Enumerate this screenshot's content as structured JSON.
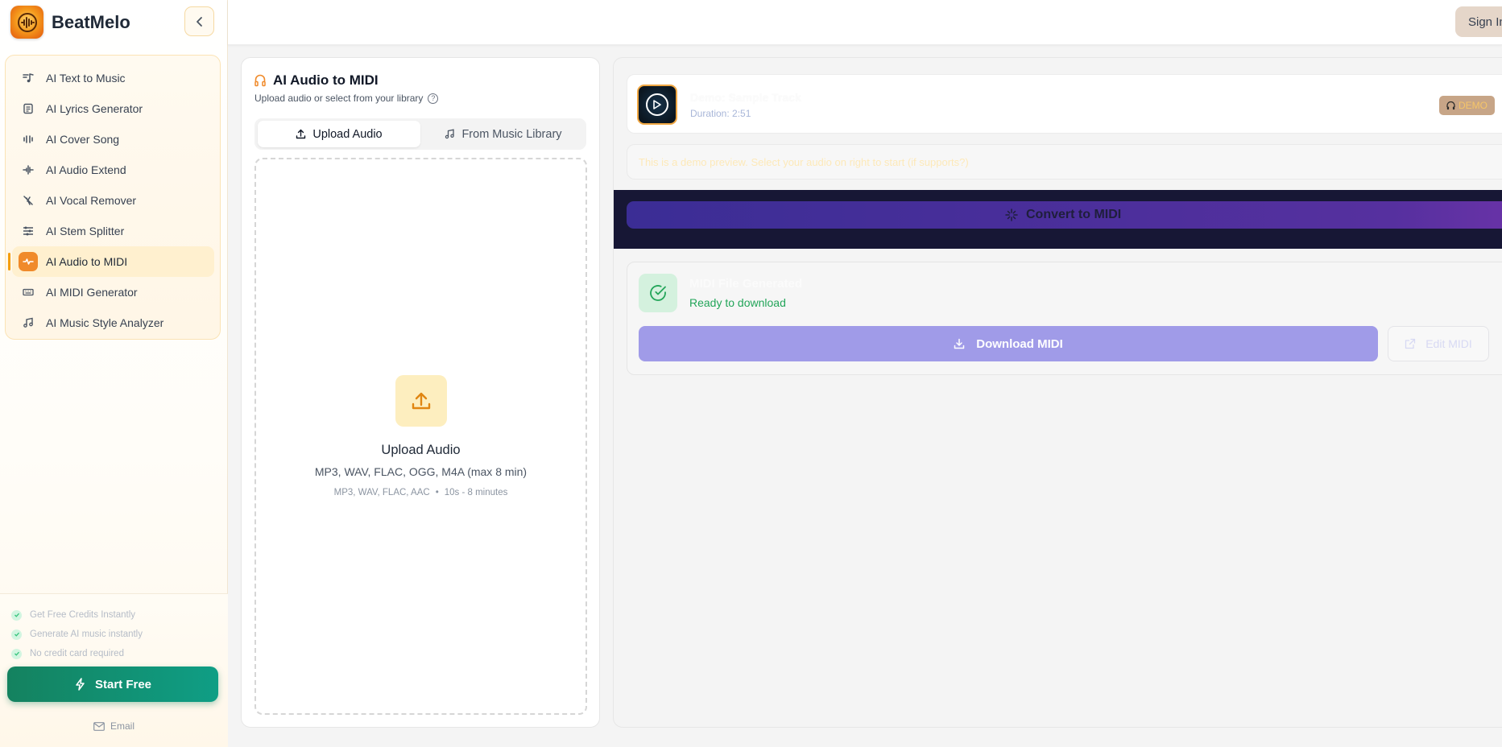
{
  "app": {
    "name": "BeatMelo"
  },
  "sidebar": {
    "items": [
      {
        "label": "AI Text to Music",
        "icon": "text-music-icon"
      },
      {
        "label": "AI Lyrics Generator",
        "icon": "lyrics-icon"
      },
      {
        "label": "AI Cover Song",
        "icon": "cover-icon"
      },
      {
        "label": "AI Audio Extend",
        "icon": "extend-icon"
      },
      {
        "label": "AI Vocal Remover",
        "icon": "mic-off-icon"
      },
      {
        "label": "AI Stem Splitter",
        "icon": "sliders-icon"
      },
      {
        "label": "AI Audio to MIDI",
        "icon": "midi-icon",
        "active": true
      },
      {
        "label": "AI MIDI Generator",
        "icon": "keyboard-icon"
      },
      {
        "label": "AI Music Style Analyzer",
        "icon": "music-note-icon"
      }
    ],
    "perks": [
      "Get Free Credits Instantly",
      "Generate AI music instantly",
      "No credit card required"
    ],
    "start_button": "Start Free",
    "email_link": "Email"
  },
  "header": {
    "sign_in": "Sign In"
  },
  "left_panel": {
    "title": "AI Audio to MIDI",
    "subtitle": "Upload audio or select from your library",
    "tabs": {
      "upload": "Upload Audio",
      "library": "From Music Library"
    },
    "dropzone": {
      "title": "Upload Audio",
      "formats": "MP3, WAV, FLAC, OGG, M4A (max 8 min)",
      "hint_formats": "MP3, WAV, FLAC, AAC",
      "hint_duration": "10s - 8 minutes"
    }
  },
  "right_panel": {
    "track": {
      "name": "Demo: Sample Track",
      "duration": "Duration: 2:51",
      "badge": "DEMO"
    },
    "notice": "This is a demo preview. Select your audio on right to start (if supports?)",
    "convert_button": "Convert to MIDI",
    "result": {
      "title": "MIDI File Generated",
      "status": "Ready to download",
      "download_button": "Download MIDI",
      "edit_button": "Edit MIDI"
    }
  },
  "colors": {
    "accent_orange": "#f08a2a",
    "start_green": "#14825f",
    "download_purple": "#a09be8",
    "convert_purple": "#3b2d95",
    "success_green": "#22a559"
  }
}
